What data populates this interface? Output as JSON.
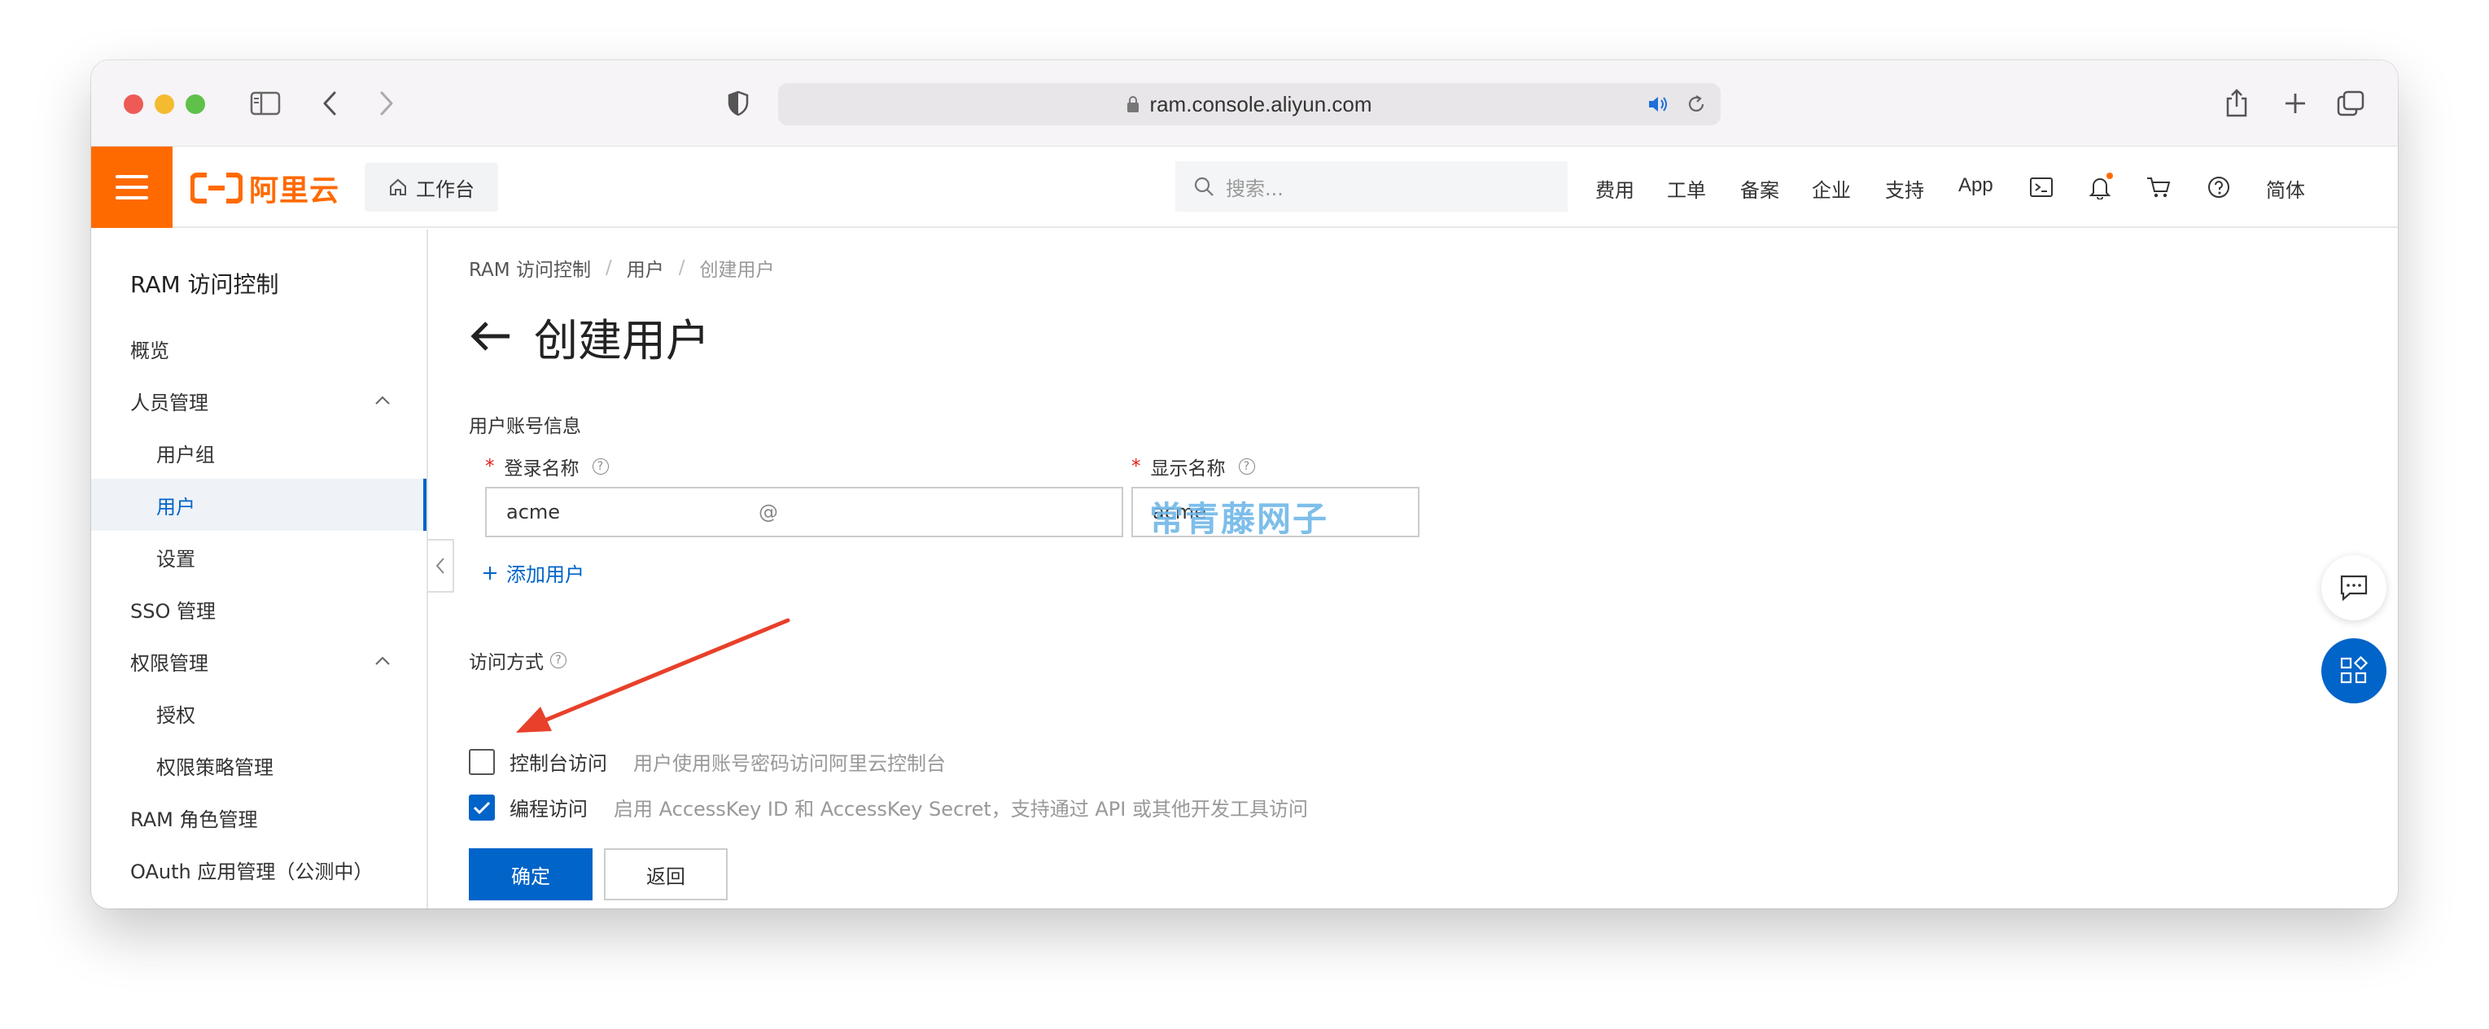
{
  "browser": {
    "url": "ram.console.aliyun.com"
  },
  "topnav": {
    "logo_text": "阿里云",
    "workbench_label": "工作台",
    "search_placeholder": "搜索...",
    "items": [
      "费用",
      "工单",
      "备案",
      "企业",
      "支持",
      "App"
    ],
    "lang": "简体"
  },
  "sidebar": {
    "title": "RAM 访问控制",
    "items": [
      {
        "label": "概览",
        "level": 1
      },
      {
        "label": "人员管理",
        "level": 1,
        "expanded": true
      },
      {
        "label": "用户组",
        "level": 2
      },
      {
        "label": "用户",
        "level": 2,
        "active": true
      },
      {
        "label": "设置",
        "level": 2
      },
      {
        "label": "SSO 管理",
        "level": 1
      },
      {
        "label": "权限管理",
        "level": 1,
        "expanded": true
      },
      {
        "label": "授权",
        "level": 2
      },
      {
        "label": "权限策略管理",
        "level": 2
      },
      {
        "label": "RAM 角色管理",
        "level": 1
      },
      {
        "label": "OAuth 应用管理（公测中）",
        "level": 1
      }
    ]
  },
  "breadcrumb": [
    "RAM 访问控制",
    "用户",
    "创建用户"
  ],
  "page_title": "创建用户",
  "form": {
    "section_account": "用户账号信息",
    "login_name_label": "登录名称",
    "display_name_label": "显示名称",
    "login_name_value": "acme",
    "login_domain_prefix": "@",
    "display_name_value": "acme",
    "add_user_label": "添加用户",
    "section_access": "访问方式",
    "console_access_label": "控制台访问",
    "console_access_desc": "用户使用账号密码访问阿里云控制台",
    "console_access_checked": false,
    "programmatic_access_label": "编程访问",
    "programmatic_access_desc": "启用 AccessKey ID 和 AccessKey Secret，支持通过 API 或其他开发工具访问",
    "programmatic_access_checked": true,
    "confirm_label": "确定",
    "back_label": "返回"
  },
  "watermark": "常青藤网子",
  "colors": {
    "brand_orange": "#ff6a00",
    "primary_blue": "#0064c8",
    "annotation_red": "#e8402a"
  }
}
